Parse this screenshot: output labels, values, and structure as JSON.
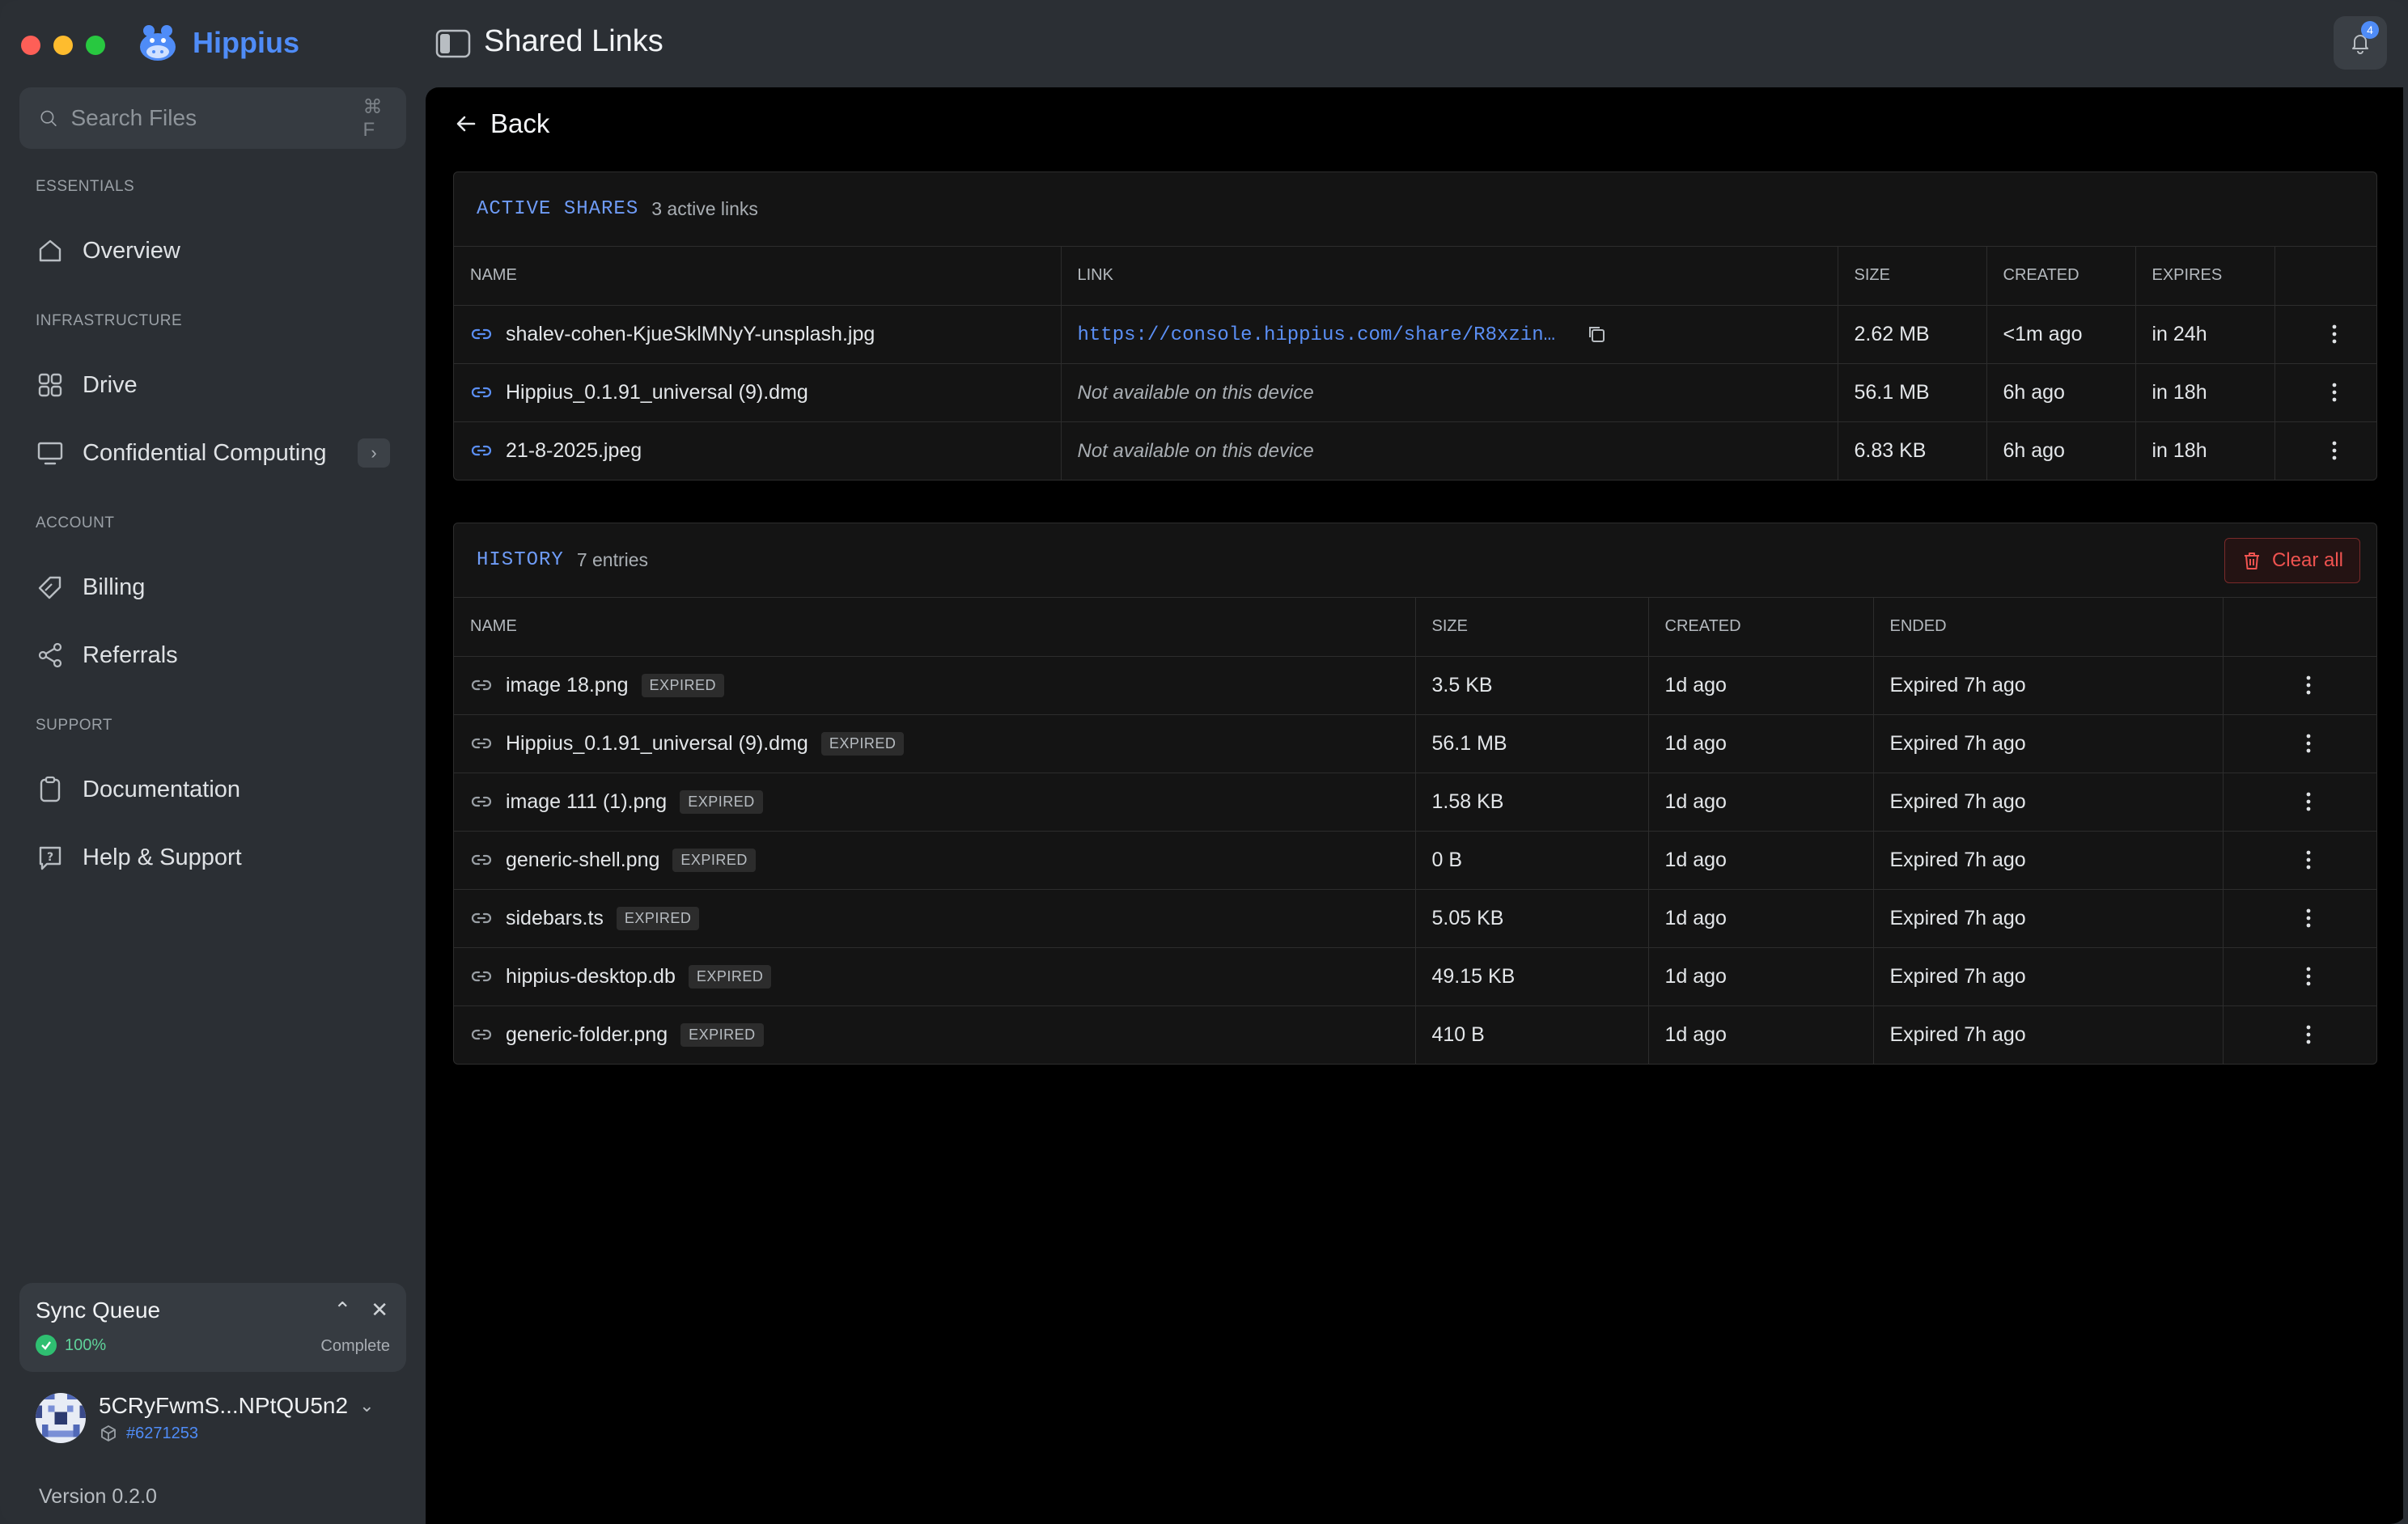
{
  "app": {
    "name": "Hippius"
  },
  "header": {
    "title": "Shared Links",
    "notification_count": "4"
  },
  "sidebar": {
    "search": {
      "placeholder": "Search Files",
      "shortcut": "⌘ F"
    },
    "sections": {
      "essentials": "ESSENTIALS",
      "infrastructure": "INFRASTRUCTURE",
      "account": "ACCOUNT",
      "support": "SUPPORT"
    },
    "items": {
      "overview": "Overview",
      "drive": "Drive",
      "confidential": "Confidential Computing",
      "billing": "Billing",
      "referrals": "Referrals",
      "documentation": "Documentation",
      "help": "Help & Support"
    },
    "sync": {
      "title": "Sync Queue",
      "percent": "100%",
      "status": "Complete"
    },
    "account": {
      "name": "5CRyFwmS...NPtQU5n2",
      "id": "#6271253"
    },
    "version": "Version 0.2.0"
  },
  "main": {
    "back_label": "Back",
    "active": {
      "kicker": "ACTIVE SHARES",
      "count": "3 active links",
      "columns": [
        "NAME",
        "LINK",
        "SIZE",
        "CREATED",
        "EXPIRES"
      ],
      "rows": [
        {
          "name": "shalev-cohen-KjueSklMNyY-unsplash.jpg",
          "link": "https://console.hippius.com/share/R8xzin…",
          "link_available": true,
          "size": "2.62 MB",
          "created": "<1m ago",
          "expires": "in 24h"
        },
        {
          "name": "Hippius_0.1.91_universal (9).dmg",
          "link": "Not available on this device",
          "link_available": false,
          "size": "56.1 MB",
          "created": "6h ago",
          "expires": "in 18h"
        },
        {
          "name": "21-8-2025.jpeg",
          "link": "Not available on this device",
          "link_available": false,
          "size": "6.83 KB",
          "created": "6h ago",
          "expires": "in 18h"
        }
      ]
    },
    "history": {
      "kicker": "HISTORY",
      "count": "7 entries",
      "clear_label": "Clear all",
      "columns": [
        "NAME",
        "SIZE",
        "CREATED",
        "ENDED"
      ],
      "badge": "EXPIRED",
      "rows": [
        {
          "name": "image 18.png",
          "size": "3.5 KB",
          "created": "1d ago",
          "ended": "Expired 7h ago"
        },
        {
          "name": "Hippius_0.1.91_universal (9).dmg",
          "size": "56.1 MB",
          "created": "1d ago",
          "ended": "Expired 7h ago"
        },
        {
          "name": "image 111 (1).png",
          "size": "1.58 KB",
          "created": "1d ago",
          "ended": "Expired 7h ago"
        },
        {
          "name": "generic-shell.png",
          "size": "0 B",
          "created": "1d ago",
          "ended": "Expired 7h ago"
        },
        {
          "name": "sidebars.ts",
          "size": "5.05 KB",
          "created": "1d ago",
          "ended": "Expired 7h ago"
        },
        {
          "name": "hippius-desktop.db",
          "size": "49.15 KB",
          "created": "1d ago",
          "ended": "Expired 7h ago"
        },
        {
          "name": "generic-folder.png",
          "size": "410 B",
          "created": "1d ago",
          "ended": "Expired 7h ago"
        }
      ]
    }
  },
  "colors": {
    "accent": "#4f8cf7",
    "danger": "#ef5350",
    "success": "#2fbf71"
  }
}
